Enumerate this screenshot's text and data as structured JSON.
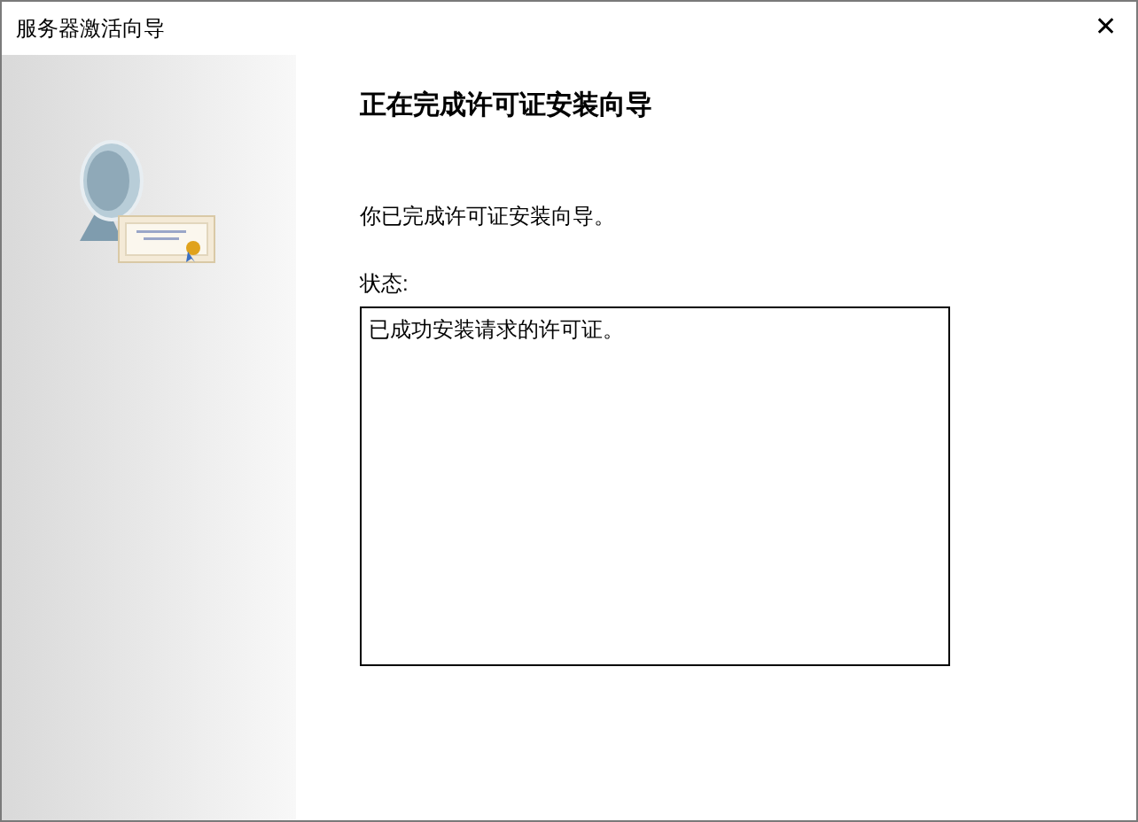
{
  "window": {
    "title": "服务器激活向导",
    "close": "✕"
  },
  "heading": "正在完成许可证安装向导",
  "message": "你已完成许可证安装向导。",
  "status": {
    "label": "状态:",
    "value": "已成功安装请求的许可证。"
  }
}
